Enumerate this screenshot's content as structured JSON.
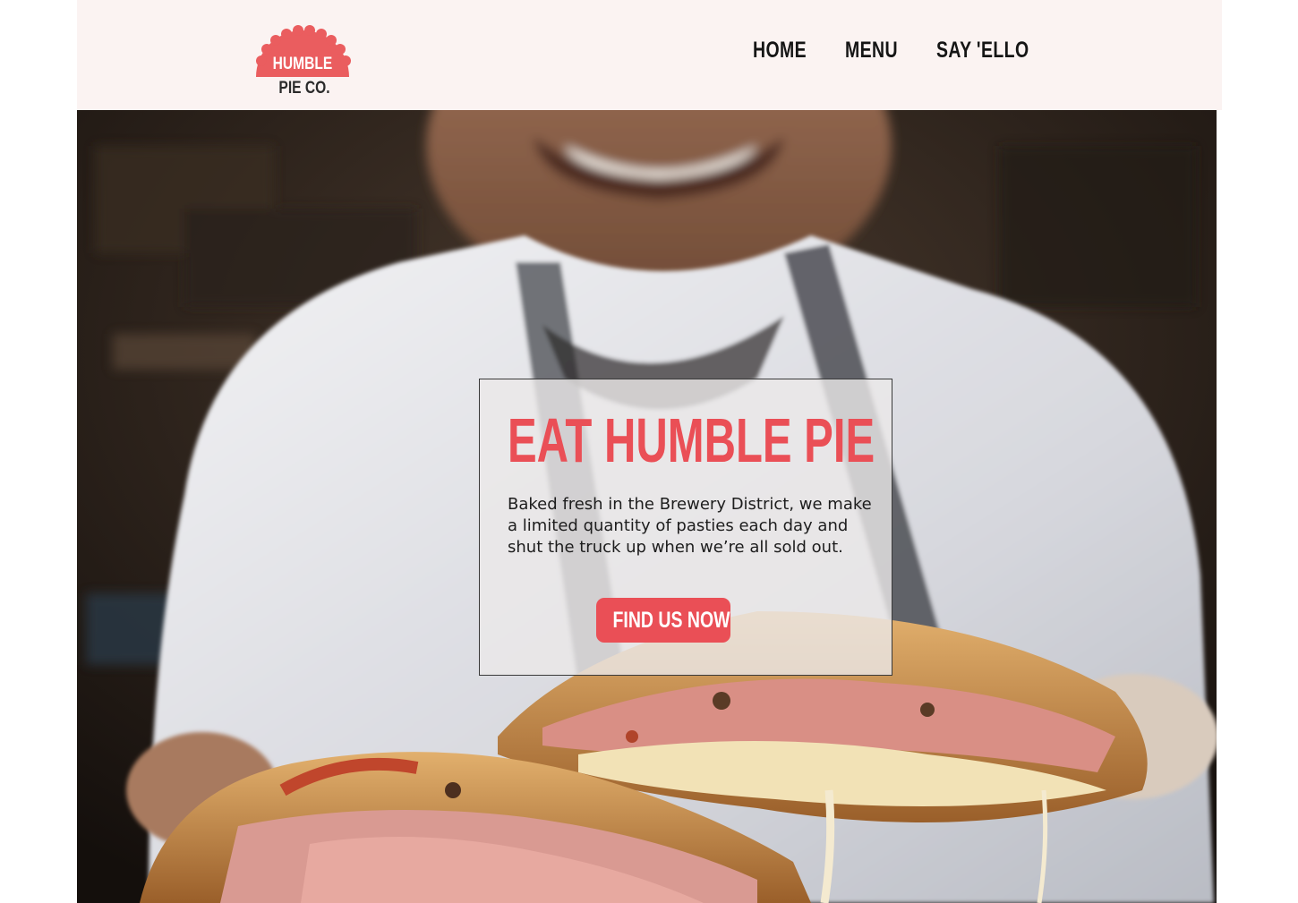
{
  "brand": {
    "logo_top": "HUMBLE",
    "logo_bottom": "PIE CO.",
    "accent_color": "#ea4f56"
  },
  "nav": {
    "items": [
      {
        "label": "HOME"
      },
      {
        "label": "MENU"
      },
      {
        "label": "SAY 'ELLO"
      }
    ]
  },
  "hero": {
    "title": "EAT HUMBLE PIE",
    "text": "Baked fresh in the Brewery District, we make a limited quantity of pasties each day and shut the truck up when we’re all sold out.",
    "button_label": "FIND US NOW",
    "image": "chef-holding-pasties-photo"
  }
}
